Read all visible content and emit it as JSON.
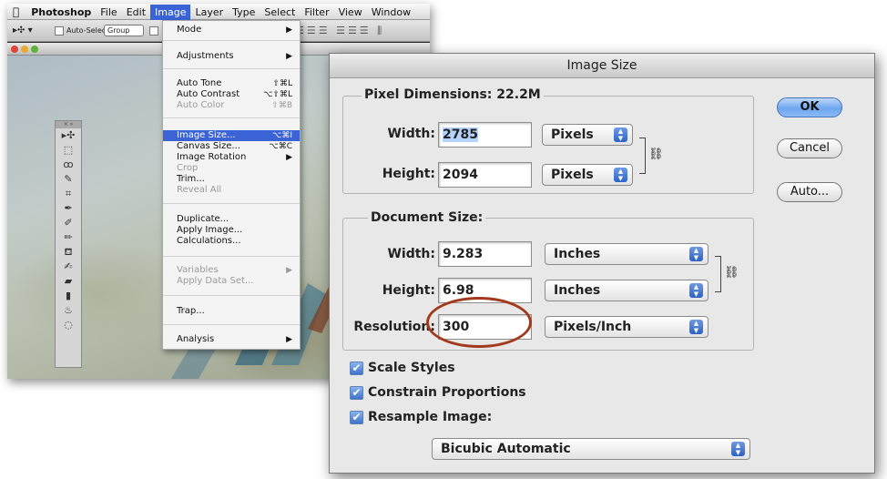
{
  "photoshop": {
    "menubar": [
      "Photoshop",
      "File",
      "Edit",
      "Image",
      "Layer",
      "Type",
      "Select",
      "Filter",
      "View",
      "Window"
    ],
    "options_bar": {
      "auto_select_label": "Auto-Select:",
      "auto_select_value": "Group"
    }
  },
  "image_menu": {
    "items": [
      {
        "label": "Mode",
        "shortcut": "▶"
      },
      {
        "label": "Adjustments",
        "shortcut": "▶"
      },
      {
        "label": "Auto Tone",
        "shortcut": "⇧⌘L"
      },
      {
        "label": "Auto Contrast",
        "shortcut": "⌥⇧⌘L"
      },
      {
        "label": "Auto Color",
        "shortcut": "⇧⌘B"
      },
      {
        "label": "Image Size...",
        "shortcut": "⌥⌘I"
      },
      {
        "label": "Canvas Size...",
        "shortcut": "⌥⌘C"
      },
      {
        "label": "Image Rotation",
        "shortcut": "▶"
      },
      {
        "label": "Crop",
        "shortcut": ""
      },
      {
        "label": "Trim...",
        "shortcut": ""
      },
      {
        "label": "Reveal All",
        "shortcut": ""
      },
      {
        "label": "Duplicate...",
        "shortcut": ""
      },
      {
        "label": "Apply Image...",
        "shortcut": ""
      },
      {
        "label": "Calculations...",
        "shortcut": ""
      },
      {
        "label": "Variables",
        "shortcut": "▶"
      },
      {
        "label": "Apply Data Set...",
        "shortcut": ""
      },
      {
        "label": "Trap...",
        "shortcut": ""
      },
      {
        "label": "Analysis",
        "shortcut": "▶"
      }
    ]
  },
  "dialog": {
    "title": "Image Size",
    "pixel_dimensions": {
      "title": "Pixel Dimensions:",
      "size": "22.2M",
      "width_label": "Width:",
      "width_value": "2785",
      "height_label": "Height:",
      "height_value": "2094",
      "unit": "Pixels"
    },
    "document_size": {
      "title": "Document Size:",
      "width_label": "Width:",
      "width_value": "9.283",
      "height_label": "Height:",
      "height_value": "6.98",
      "unit": "Inches",
      "resolution_label": "Resolution:",
      "resolution_value": "300",
      "resolution_unit": "Pixels/Inch"
    },
    "buttons": {
      "ok": "OK",
      "cancel": "Cancel",
      "auto": "Auto..."
    },
    "checkboxes": {
      "scale_styles": "Scale Styles",
      "constrain": "Constrain Proportions",
      "resample": "Resample Image:"
    },
    "resample_method": "Bicubic Automatic"
  }
}
